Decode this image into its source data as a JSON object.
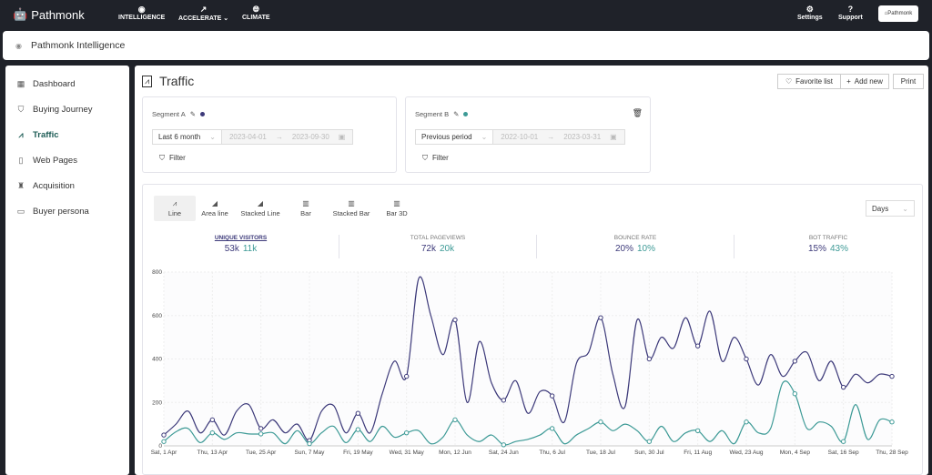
{
  "topbar": {
    "logo": "Pathmonk",
    "nav": [
      {
        "label": "INTELLIGENCE",
        "icon": "brain-icon"
      },
      {
        "label": "ACCELERATE",
        "icon": "trend-icon"
      },
      {
        "label": "CLIMATE",
        "icon": "globe-icon"
      }
    ],
    "settings": "Settings",
    "support": "Support",
    "brand": "Pathmonk"
  },
  "subheader": {
    "title": "Pathmonk Intelligence"
  },
  "sidebar": {
    "items": [
      {
        "label": "Dashboard",
        "icon": "grid-icon"
      },
      {
        "label": "Buying Journey",
        "icon": "funnel-icon"
      },
      {
        "label": "Traffic",
        "icon": "chart-line-icon",
        "active": true
      },
      {
        "label": "Web Pages",
        "icon": "page-icon"
      },
      {
        "label": "Acquisition",
        "icon": "trophy-icon"
      },
      {
        "label": "Buyer persona",
        "icon": "id-card-icon"
      }
    ]
  },
  "page": {
    "title": "Traffic",
    "favorite": "Favorite list",
    "add_new": "Add new",
    "print": "Print"
  },
  "segments": [
    {
      "label": "Segment A",
      "color": "#3d3a7a",
      "preset": "Last 6 month",
      "start": "2023-04-01",
      "end": "2023-09-30",
      "filter": "Filter"
    },
    {
      "label": "Segment B",
      "color": "#3d9a96",
      "preset": "Previous period",
      "start": "2022-10-01",
      "end": "2023-03-31",
      "filter": "Filter"
    }
  ],
  "chart_types": [
    "Line",
    "Area line",
    "Stacked Line",
    "Bar",
    "Stacked Bar",
    "Bar 3D"
  ],
  "granularity": "Days",
  "metrics": [
    {
      "name": "UNIQUE VISITORS",
      "a": "53k",
      "b": "11k"
    },
    {
      "name": "TOTAL PAGEVIEWS",
      "a": "72k",
      "b": "20k"
    },
    {
      "name": "BOUNCE RATE",
      "a": "20%",
      "b": "10%"
    },
    {
      "name": "BOT TRAFFIC",
      "a": "15%",
      "b": "43%"
    }
  ],
  "chart_data": {
    "type": "line",
    "ylim": [
      0,
      800
    ],
    "yticks": [
      0,
      200,
      400,
      600,
      800
    ],
    "grid": true,
    "xtick_labels": [
      "Sat, 1 Apr",
      "Thu, 13 Apr",
      "Tue, 25 Apr",
      "Sun, 7 May",
      "Fri, 19 May",
      "Wed, 31 May",
      "Mon, 12 Jun",
      "Sat, 24 Jun",
      "Thu, 6 Jul",
      "Tue, 18 Jul",
      "Sun, 30 Jul",
      "Fri, 11 Aug",
      "Wed, 23 Aug",
      "Mon, 4 Sep",
      "Sat, 16 Sep",
      "Thu, 28 Sep"
    ],
    "x": [
      "2023-04-01",
      "2023-04-04",
      "2023-04-07",
      "2023-04-10",
      "2023-04-13",
      "2023-04-16",
      "2023-04-19",
      "2023-04-22",
      "2023-04-25",
      "2023-04-28",
      "2023-05-01",
      "2023-05-04",
      "2023-05-07",
      "2023-05-10",
      "2023-05-13",
      "2023-05-16",
      "2023-05-19",
      "2023-05-22",
      "2023-05-25",
      "2023-05-28",
      "2023-05-31",
      "2023-06-03",
      "2023-06-06",
      "2023-06-09",
      "2023-06-12",
      "2023-06-15",
      "2023-06-18",
      "2023-06-21",
      "2023-06-24",
      "2023-06-27",
      "2023-06-30",
      "2023-07-03",
      "2023-07-06",
      "2023-07-09",
      "2023-07-12",
      "2023-07-15",
      "2023-07-18",
      "2023-07-21",
      "2023-07-24",
      "2023-07-27",
      "2023-07-30",
      "2023-08-02",
      "2023-08-05",
      "2023-08-08",
      "2023-08-11",
      "2023-08-14",
      "2023-08-17",
      "2023-08-20",
      "2023-08-23",
      "2023-08-26",
      "2023-08-29",
      "2023-09-01",
      "2023-09-04",
      "2023-09-07",
      "2023-09-10",
      "2023-09-13",
      "2023-09-16",
      "2023-09-19",
      "2023-09-22",
      "2023-09-25",
      "2023-09-28"
    ],
    "series": [
      {
        "color": "#3d3a7a",
        "values": [
          50,
          100,
          160,
          60,
          120,
          50,
          160,
          190,
          80,
          120,
          60,
          100,
          25,
          160,
          185,
          60,
          150,
          60,
          240,
          390,
          320,
          770,
          600,
          420,
          580,
          200,
          480,
          290,
          210,
          300,
          150,
          250,
          230,
          110,
          380,
          430,
          590,
          330,
          180,
          580,
          400,
          500,
          450,
          590,
          460,
          620,
          390,
          500,
          400,
          280,
          420,
          320,
          390,
          430,
          300,
          390,
          270,
          330,
          290,
          330,
          320
        ]
      },
      {
        "color": "#3d9a96",
        "values": [
          20,
          65,
          80,
          15,
          60,
          30,
          60,
          55,
          55,
          60,
          10,
          70,
          10,
          60,
          90,
          15,
          75,
          20,
          90,
          40,
          60,
          70,
          10,
          40,
          120,
          50,
          20,
          50,
          5,
          20,
          30,
          50,
          80,
          10,
          50,
          80,
          110,
          70,
          100,
          70,
          20,
          90,
          20,
          60,
          70,
          20,
          70,
          10,
          110,
          60,
          80,
          290,
          240,
          80,
          110,
          90,
          20,
          190,
          30,
          120,
          110
        ]
      }
    ]
  }
}
